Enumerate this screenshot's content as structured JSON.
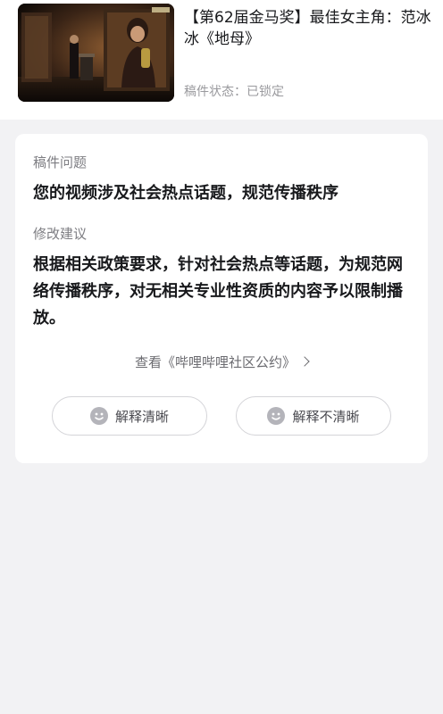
{
  "video": {
    "title": "【第62届金马奖】最佳女主角：范冰冰《地母》",
    "status_label": "稿件状态：",
    "status_value": "已锁定"
  },
  "review": {
    "problem_label": "稿件问题",
    "problem_text": "您的视频涉及社会热点话题，规范传播秩序",
    "suggestion_label": "修改建议",
    "suggestion_text": "根据相关政策要求，针对社会热点等话题，为规范网络传播秩序，对无相关专业性资质的内容予以限制播放。",
    "guideline_link": "查看《哔哩哔哩社区公约》"
  },
  "feedback": {
    "clear_label": "解释清晰",
    "unclear_label": "解释不清晰"
  },
  "icons": {
    "feedback": "smile-icon",
    "link": "chevron-right-icon"
  },
  "colors": {
    "background": "#f2f2f4",
    "card": "#ffffff",
    "muted_text": "#9a9a9e",
    "primary_text": "#18191c"
  }
}
